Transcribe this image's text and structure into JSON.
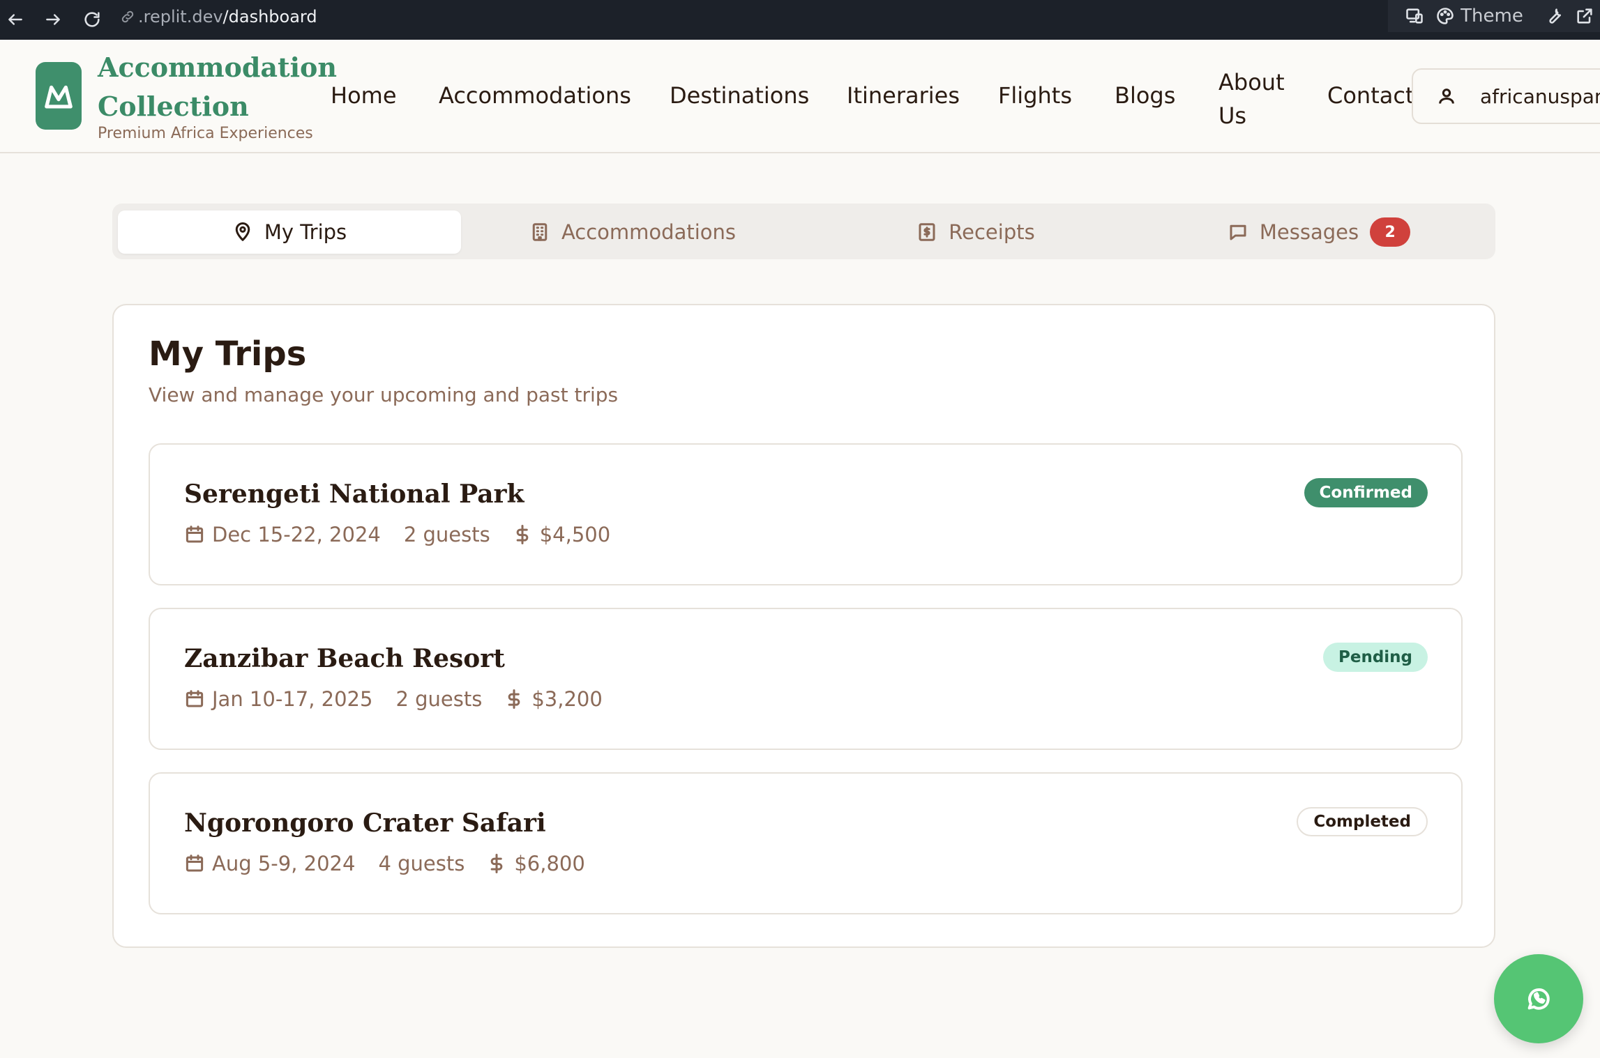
{
  "browser": {
    "url_host": ".replit.dev",
    "url_path": "/dashboard",
    "theme_label": "Theme"
  },
  "header": {
    "brand_name": "Accommodation Collection",
    "tagline": "Premium Africa Experiences",
    "nav": [
      "Home",
      "Accommodations",
      "Destinations",
      "Itineraries",
      "Flights",
      "Blogs",
      "About Us",
      "Contact"
    ],
    "account_label": "africanuspan"
  },
  "tabs": [
    {
      "label": "My Trips",
      "icon": "map-pin-icon",
      "active": true
    },
    {
      "label": "Accommodations",
      "icon": "building-icon",
      "active": false
    },
    {
      "label": "Receipts",
      "icon": "receipt-icon",
      "active": false
    },
    {
      "label": "Messages",
      "icon": "message-icon",
      "active": false,
      "badge": "2"
    }
  ],
  "trips_section": {
    "title": "My Trips",
    "subtitle": "View and manage your upcoming and past trips",
    "trips": [
      {
        "name": "Serengeti National Park",
        "dates": "Dec 15-22, 2024",
        "guests": "2 guests",
        "price": "$4,500",
        "status": "Confirmed"
      },
      {
        "name": "Zanzibar Beach Resort",
        "dates": "Jan 10-17, 2025",
        "guests": "2 guests",
        "price": "$3,200",
        "status": "Pending"
      },
      {
        "name": "Ngorongoro Crater Safari",
        "dates": "Aug 5-9, 2024",
        "guests": "4 guests",
        "price": "$6,800",
        "status": "Completed"
      }
    ]
  },
  "colors": {
    "brand_green": "#3f8f6c",
    "badge_red": "#d0413c",
    "pending_bg": "#c8f2e3",
    "whatsapp_green": "#55c574"
  }
}
